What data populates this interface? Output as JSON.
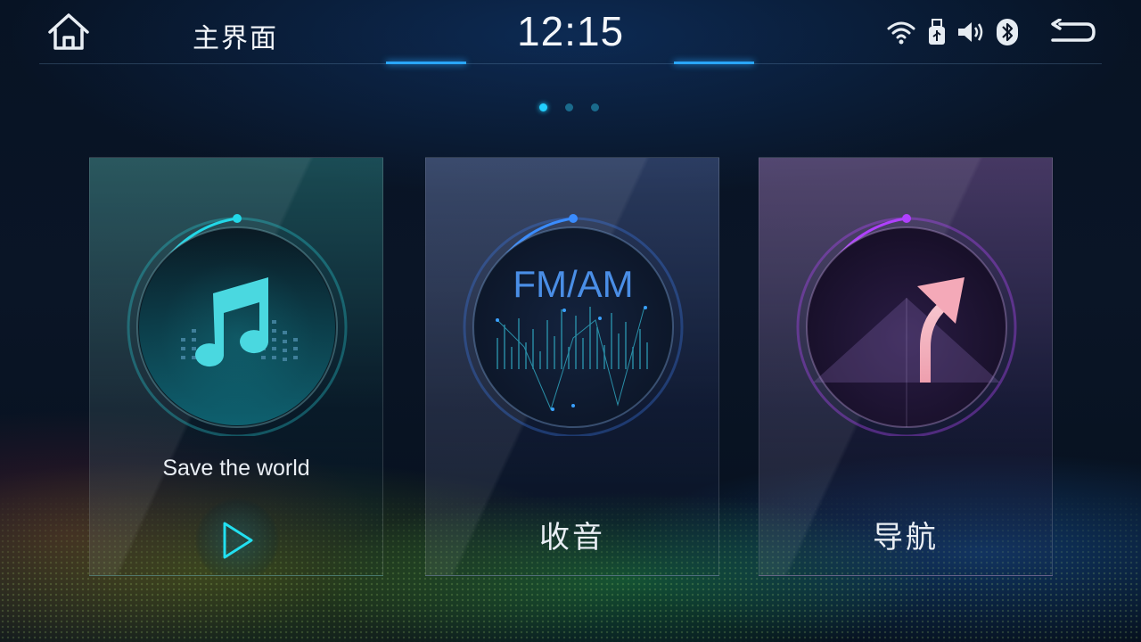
{
  "header": {
    "title": "主界面",
    "time": "12:15",
    "icons": [
      "home-icon",
      "wifi-icon",
      "usb-icon",
      "volume-icon",
      "bluetooth-icon",
      "back-icon"
    ]
  },
  "pager": {
    "count": 3,
    "active": 0
  },
  "cards": [
    {
      "id": "music",
      "label": "Save the world",
      "icon": "music-note-icon",
      "accent": "#22d8e8"
    },
    {
      "id": "radio",
      "label": "收音",
      "dial_text": "FM/AM",
      "icon": "radio-wave-icon",
      "accent": "#3a8cff"
    },
    {
      "id": "navigation",
      "label": "导航",
      "icon": "turn-right-arrow-icon",
      "accent": "#b040ff"
    }
  ],
  "colors": {
    "accent_blue": "#2aa6ff",
    "music": "#22d8e8",
    "radio": "#3a8cff",
    "nav": "#b040ff"
  }
}
